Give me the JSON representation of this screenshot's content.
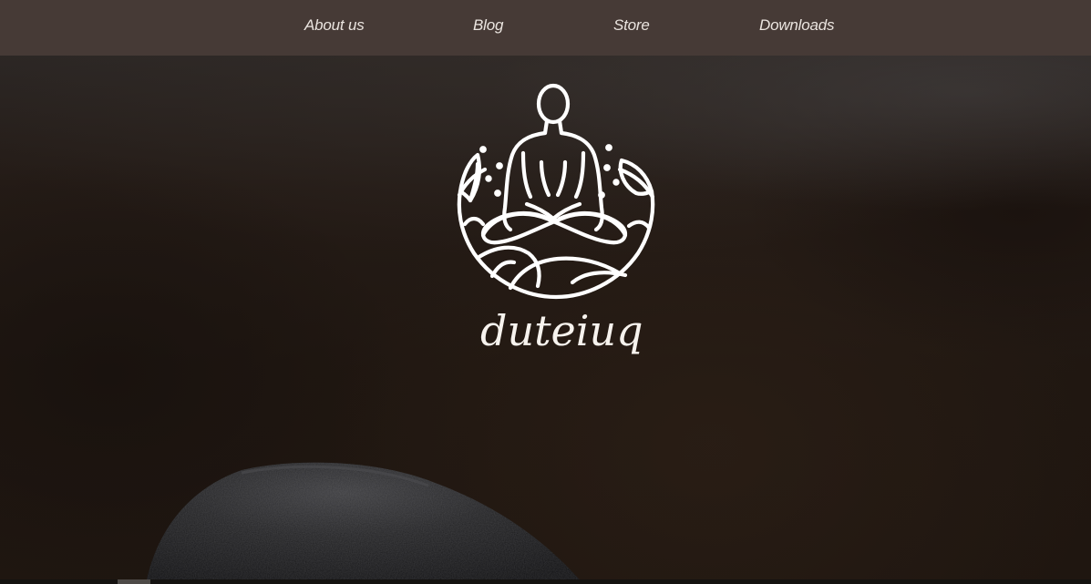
{
  "nav": {
    "about_label": "About us",
    "blog_label": "Blog",
    "store_label": "Store",
    "downloads_label": "Downloads"
  },
  "brand": {
    "name": "duteiuq",
    "logo_icon": "meditating-figure-icon"
  },
  "colors": {
    "nav_background": "#463a36",
    "nav_text": "#eae4df",
    "logo_stroke": "#ffffff",
    "hero_background": "#201711"
  }
}
